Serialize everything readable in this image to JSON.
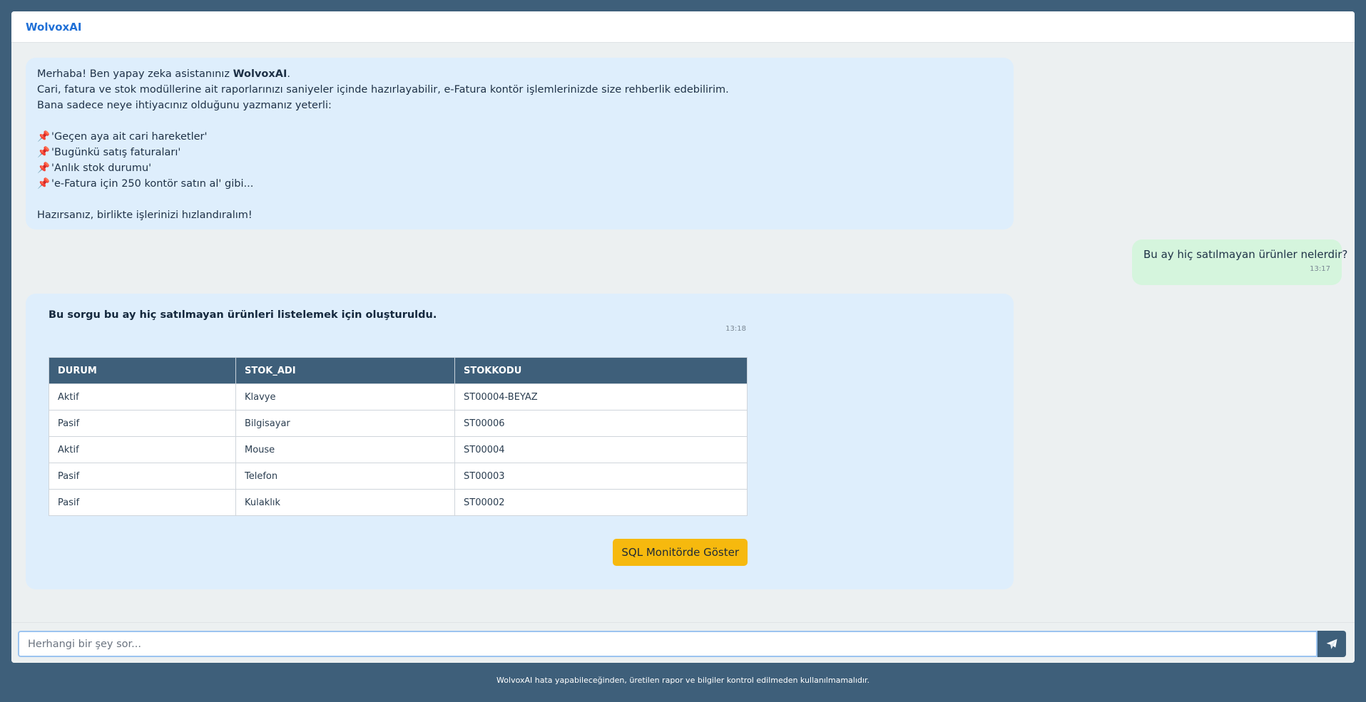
{
  "header": {
    "brand": "WolvoxAI"
  },
  "welcome": {
    "greeting_prefix": "Merhaba! Ben yapay zeka asistanınız ",
    "greeting_name": "WolvoxAI",
    "greeting_suffix": ".",
    "line2": "Cari, fatura ve stok modüllerine ait raporlarınızı saniyeler içinde hazırlayabilir, e-Fatura kontör işlemlerinizde size rehberlik edebilirim.",
    "line3": "Bana sadece neye ihtiyacınız olduğunu yazmanız yeterli:",
    "examples": [
      "'Geçen aya ait cari hareketler'",
      "'Bugünkü satış faturaları'",
      "'Anlık stok durumu'",
      "'e-Fatura için 250 kontör satın al' gibi..."
    ],
    "closing": "Hazırsanız, birlikte işlerinizi hızlandıralım!"
  },
  "user_message": {
    "text": "Bu ay hiç satılmayan ürünler nelerdir?",
    "time": "13:17"
  },
  "answer": {
    "title": "Bu sorgu bu ay hiç satılmayan ürünleri listelemek için oluşturuldu.",
    "time": "13:18",
    "columns": [
      "DURUM",
      "STOK_ADI",
      "STOKKODU"
    ],
    "rows": [
      [
        "Aktif",
        "Klavye",
        "ST00004-BEYAZ"
      ],
      [
        "Pasif",
        "Bilgisayar",
        "ST00006"
      ],
      [
        "Aktif",
        "Mouse",
        "ST00004"
      ],
      [
        "Pasif",
        "Telefon",
        "ST00003"
      ],
      [
        "Pasif",
        "Kulaklık",
        "ST00002"
      ]
    ],
    "sql_button": "SQL Monitörde Göster"
  },
  "composer": {
    "placeholder": "Herhangi bir şey sor...",
    "send_icon": "paper-plane-icon"
  },
  "footer": {
    "disclaimer": "WolvoxAI hata yapabileceğinden, üretilen rapor ve bilgiler kontrol edilmeden kullanılmamalıdır."
  },
  "colors": {
    "accent": "#3e5f7a",
    "brand": "#1f6fd6",
    "button": "#f6b90e",
    "bot_bubble": "#deeefc",
    "user_bubble": "#d5f5dd"
  }
}
